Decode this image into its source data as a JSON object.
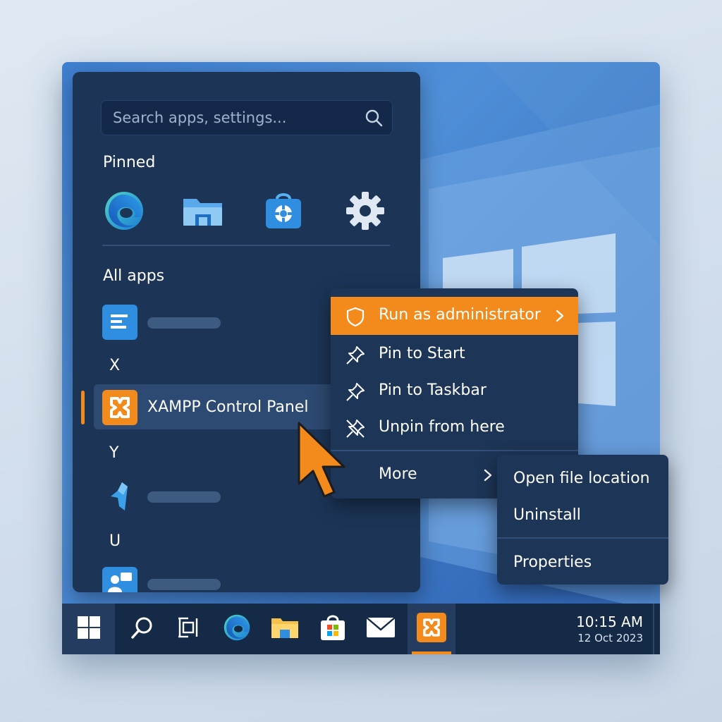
{
  "start_menu": {
    "search": {
      "placeholder": "Search apps, settings..."
    },
    "pinned": {
      "title": "Pinned",
      "items": [
        {
          "icon": "edge-icon"
        },
        {
          "icon": "file-explorer-icon"
        },
        {
          "icon": "store-icon"
        },
        {
          "icon": "settings-icon"
        }
      ]
    },
    "all_apps": {
      "title": "All apps",
      "groups": [
        {
          "letter": "X",
          "app": "XAMPP Control Panel"
        },
        {
          "letter": "Y"
        },
        {
          "letter": "U"
        }
      ]
    }
  },
  "context_menu": {
    "items": [
      {
        "label": "Run as administrator",
        "icon": "shield-icon",
        "highlighted": true
      },
      {
        "label": "Pin to Start",
        "icon": "pin-icon"
      },
      {
        "label": "Pin to Taskbar",
        "icon": "pin-icon"
      },
      {
        "label": "Unpin from here",
        "icon": "unpin-icon"
      },
      {
        "label": "More"
      }
    ]
  },
  "submenu": {
    "items": [
      {
        "label": "Open file location"
      },
      {
        "label": "Uninstall"
      },
      {
        "label": "Properties"
      }
    ]
  },
  "taskbar": {
    "icons": [
      "windows-start-icon",
      "search-icon",
      "task-view-icon",
      "edge-icon",
      "file-explorer-icon",
      "store-icon",
      "mail-icon",
      "xampp-icon"
    ],
    "clock": {
      "time": "10:15 AM",
      "date": "12 Oct 2023"
    }
  },
  "colors": {
    "accent": "#f28a1c",
    "menu_bg": "#1c3557",
    "taskbar_bg": "#152a47",
    "wallpaper": "#3f7fd0"
  }
}
